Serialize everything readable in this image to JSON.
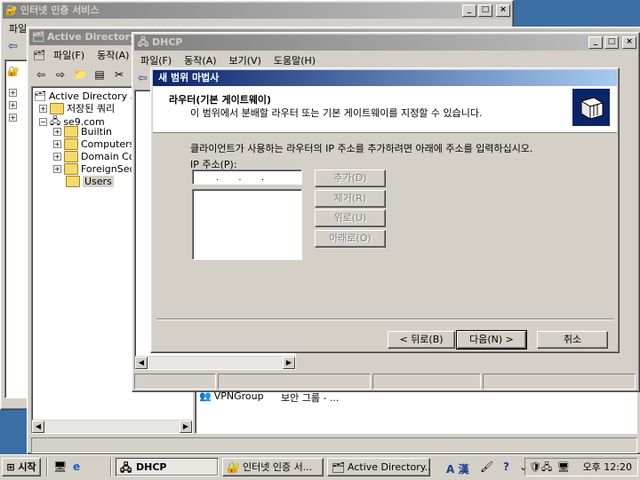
{
  "win_ias": {
    "title": "인터넷 인증 서비스",
    "menu_file": "파일",
    "menu_hidden": "..."
  },
  "win_ad": {
    "title": "Active Directory 사용자 및 컴퓨터",
    "menu": [
      "파일(F)",
      "동작(A)"
    ],
    "tree_root": "Active Directory 사",
    "tree": [
      {
        "label": "저장된 쿼리"
      },
      {
        "label": "se9.com"
      },
      {
        "label": "Builtin"
      },
      {
        "label": "Computers"
      },
      {
        "label": "Domain Co"
      },
      {
        "label": "ForeignSec"
      },
      {
        "label": "Users"
      }
    ],
    "list_row": {
      "name": "VPNGroup",
      "type": "보안 그룹 - ..."
    }
  },
  "win_dhcp": {
    "title": "DHCP",
    "menu": [
      "파일(F)",
      "동작(A)",
      "보기(V)",
      "도움말(H)"
    ]
  },
  "wizard": {
    "title": "새 범위 마법사",
    "header_title": "라우터(기본 게이트웨이)",
    "header_subtitle": "이 범위에서 분배할 라우터 또는 기본 게이트웨이를 지정할 수 있습니다.",
    "instruction": "클라이언트가 사용하는 라우터의 IP 주소를 추가하려면 아래에 주소를 입력하십시오.",
    "ip_label": "IP 주소(P):",
    "ip_value": ".       .       .",
    "btn_add": "추가(D)",
    "btn_remove": "제거(R)",
    "btn_up": "위로(U)",
    "btn_down": "아래로(O)",
    "btn_back": "< 뒤로(B)",
    "btn_next": "다음(N) >",
    "btn_cancel": "취소"
  },
  "taskbar": {
    "start": "시작",
    "tasks": [
      "DHCP",
      "인터넷 인증 서...",
      "Active Directory..."
    ],
    "clock": "오후 12:20",
    "lang": "A 漢"
  }
}
